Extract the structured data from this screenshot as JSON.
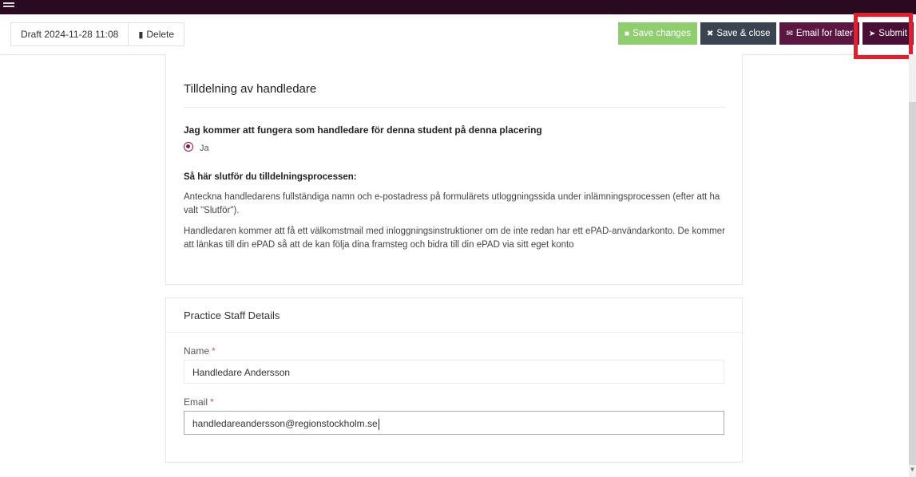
{
  "toolbar": {
    "draft_label": "Draft 2024-11-28 11:08",
    "delete_label": "Delete",
    "save_changes_label": "Save changes",
    "save_close_label": "Save & close",
    "email_later_label": "Email for later",
    "submit_label": "Submit"
  },
  "assignment_card": {
    "title": "Tilldelning av handledare",
    "question": "Jag kommer att fungera som handledare för denna student på denna placering",
    "option_label": "Ja",
    "option_selected": true,
    "howto_heading": "Så här slutför du tilldelningsprocessen:",
    "paragraph1": "Anteckna handledarens fullständiga namn och e-postadress på formulärets utloggningssida under inlämningsprocessen (efter att ha valt \"Slutför\").",
    "paragraph2": "Handledaren kommer att få ett välkomstmail med inloggningsinstruktioner om de inte redan har ett ePAD-användarkonto. De kommer att länkas till din ePAD så att de kan följa dina framsteg och bidra till din ePAD via sitt eget konto"
  },
  "staff_card": {
    "title": "Practice Staff Details",
    "name_label": "Name",
    "name_value": "Handledare Andersson",
    "email_label": "Email",
    "email_value": "handledareandersson@regionstockholm.se",
    "required_mark": "*"
  },
  "colors": {
    "save_changes": "#8fce6f",
    "save_close": "#3a4450",
    "email_later": "#5b1741",
    "submit": "#4a0f35",
    "highlight": "#e61e2c"
  }
}
